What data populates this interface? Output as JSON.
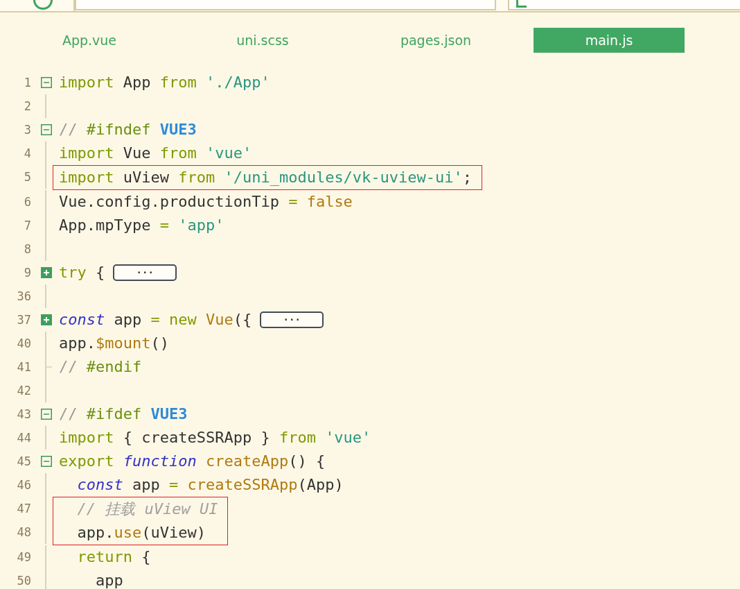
{
  "tabs": [
    {
      "label": "App.vue",
      "selected": false
    },
    {
      "label": "uni.scss",
      "selected": false
    },
    {
      "label": "pages.json",
      "selected": false
    },
    {
      "label": "main.js",
      "selected": true
    }
  ],
  "lines": [
    {
      "number": "1",
      "kind": "open",
      "highlighted": false,
      "tokens": [
        {
          "kind": "keyword",
          "s": "import "
        },
        {
          "kind": "plain",
          "s": "App "
        },
        {
          "kind": "keyword",
          "s": "from "
        },
        {
          "kind": "string",
          "s": "'./App'"
        }
      ]
    },
    {
      "number": "2",
      "kind": "guide",
      "highlighted": false
    },
    {
      "number": "3",
      "kind": "open",
      "highlighted": false,
      "tokens": [
        {
          "kind": "comment",
          "s": "// "
        },
        {
          "kind": "directive",
          "s": "#ifndef "
        },
        {
          "kind": "macro",
          "s": "VUE3"
        }
      ]
    },
    {
      "number": "4",
      "kind": "guide",
      "highlighted": false,
      "tokens": [
        {
          "kind": "keyword",
          "s": "import "
        },
        {
          "kind": "plain",
          "s": "Vue "
        },
        {
          "kind": "keyword",
          "s": "from "
        },
        {
          "kind": "string",
          "s": "'vue'"
        }
      ]
    },
    {
      "number": "5",
      "kind": "guide",
      "highlighted": true,
      "tokens": [
        {
          "kind": "keyword",
          "s": "import "
        },
        {
          "kind": "plain",
          "s": "uView "
        },
        {
          "kind": "keyword",
          "s": "from "
        },
        {
          "kind": "string",
          "s": "'/uni_modules/vk-uview-ui'"
        },
        {
          "kind": "plain",
          "s": ";"
        }
      ]
    },
    {
      "number": "6",
      "kind": "guide",
      "highlighted": false,
      "tokens": [
        {
          "kind": "plain",
          "s": "Vue.config.productionTip "
        },
        {
          "kind": "keyword",
          "s": "= "
        },
        {
          "kind": "function",
          "s": "false"
        }
      ]
    },
    {
      "number": "7",
      "kind": "guide",
      "highlighted": false,
      "tokens": [
        {
          "kind": "plain",
          "s": "App.mpType "
        },
        {
          "kind": "keyword",
          "s": "= "
        },
        {
          "kind": "string",
          "s": "'app'"
        }
      ]
    },
    {
      "number": "8",
      "kind": "guide",
      "highlighted": false
    },
    {
      "number": "9",
      "kind": "closed",
      "highlighted": false,
      "placeholder": "···",
      "tokens": [
        {
          "kind": "keyword",
          "s": "try "
        },
        {
          "kind": "plain",
          "s": "{"
        }
      ]
    },
    {
      "number": "36",
      "kind": "guide",
      "highlighted": false
    },
    {
      "number": "37",
      "kind": "closed",
      "highlighted": false,
      "placeholder": "···",
      "tokens": [
        {
          "kind": "storage",
          "s": "const "
        },
        {
          "kind": "plain",
          "s": "app "
        },
        {
          "kind": "keyword",
          "s": "= new "
        },
        {
          "kind": "function",
          "s": "Vue"
        },
        {
          "kind": "plain",
          "s": "({"
        }
      ]
    },
    {
      "number": "40",
      "kind": "guide",
      "highlighted": false,
      "tokens": [
        {
          "kind": "plain",
          "s": "app."
        },
        {
          "kind": "function",
          "s": "$mount"
        },
        {
          "kind": "plain",
          "s": "()"
        }
      ]
    },
    {
      "number": "41",
      "kind": "end",
      "highlighted": false,
      "tokens": [
        {
          "kind": "comment",
          "s": "// "
        },
        {
          "kind": "directive",
          "s": "#endif"
        }
      ]
    },
    {
      "number": "42",
      "kind": "guide",
      "highlighted": false
    },
    {
      "number": "43",
      "kind": "open",
      "highlighted": false,
      "tokens": [
        {
          "kind": "comment",
          "s": "// "
        },
        {
          "kind": "directive",
          "s": "#ifdef "
        },
        {
          "kind": "macro",
          "s": "VUE3"
        }
      ]
    },
    {
      "number": "44",
      "kind": "guide",
      "highlighted": false,
      "tokens": [
        {
          "kind": "keyword",
          "s": "import "
        },
        {
          "kind": "plain",
          "s": "{ createSSRApp } "
        },
        {
          "kind": "keyword",
          "s": "from "
        },
        {
          "kind": "string",
          "s": "'vue'"
        }
      ]
    },
    {
      "number": "45",
      "kind": "open",
      "highlighted": false,
      "tokens": [
        {
          "kind": "keyword",
          "s": "export "
        },
        {
          "kind": "storage",
          "s": "function "
        },
        {
          "kind": "function",
          "s": "createApp"
        },
        {
          "kind": "plain",
          "s": "() {"
        }
      ]
    },
    {
      "number": "46",
      "kind": "guide",
      "highlighted": false,
      "tokens": [
        {
          "kind": "storage",
          "s": "  const "
        },
        {
          "kind": "plain",
          "s": "app "
        },
        {
          "kind": "keyword",
          "s": "= "
        },
        {
          "kind": "function",
          "s": "createSSRApp"
        },
        {
          "kind": "plain",
          "s": "(App)"
        }
      ]
    },
    {
      "number": "47",
      "kind": "guide",
      "highlighted": true,
      "tokens": [
        {
          "kind": "note",
          "s": "  // 挂载 uView UI"
        }
      ]
    },
    {
      "number": "48",
      "kind": "guide",
      "highlighted": true,
      "tokens": [
        {
          "kind": "plain",
          "s": "  app."
        },
        {
          "kind": "function",
          "s": "use"
        },
        {
          "kind": "plain",
          "s": "(uView)"
        }
      ]
    },
    {
      "number": "49",
      "kind": "guide",
      "highlighted": false,
      "tokens": [
        {
          "kind": "keyword",
          "s": "  return "
        },
        {
          "kind": "plain",
          "s": "{"
        }
      ]
    },
    {
      "number": "50",
      "kind": "guide",
      "highlighted": false,
      "tokens": [
        {
          "kind": "plain",
          "s": "    app"
        }
      ]
    }
  ]
}
